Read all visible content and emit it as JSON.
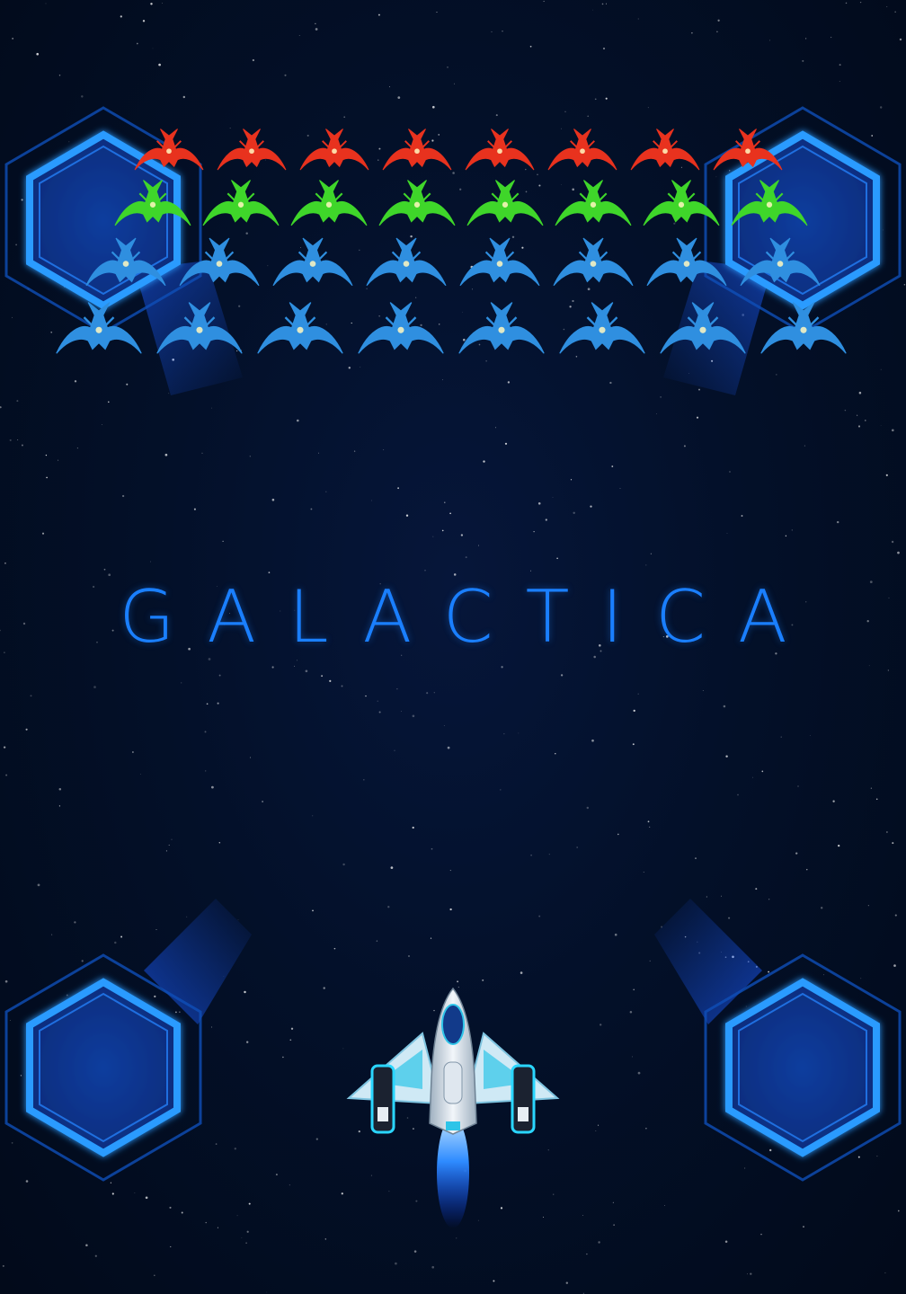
{
  "game": {
    "title": "GALACTICA"
  },
  "colors": {
    "background": "#020b1c",
    "title": "#1a7fff",
    "hex_panel": "#1e8bff",
    "enemy_row_1": "#e8321e",
    "enemy_row_2": "#3fd62a",
    "enemy_row_3": "#2f8fe0",
    "enemy_row_4": "#2f8fe0",
    "player_ship": "#e6eef5",
    "player_thruster": "#2e8bff"
  },
  "enemy_formation": {
    "rows": [
      {
        "color_key": "enemy_row_1",
        "count": 8
      },
      {
        "color_key": "enemy_row_2",
        "count": 8
      },
      {
        "color_key": "enemy_row_3",
        "count": 8
      },
      {
        "color_key": "enemy_row_4",
        "count": 8
      }
    ]
  },
  "icons": {
    "hex_panels": [
      "hex-panel-icon",
      "hex-panel-icon",
      "hex-panel-icon",
      "hex-panel-icon"
    ],
    "enemy": "alien-fighter-icon",
    "player": "player-spaceship-icon"
  }
}
